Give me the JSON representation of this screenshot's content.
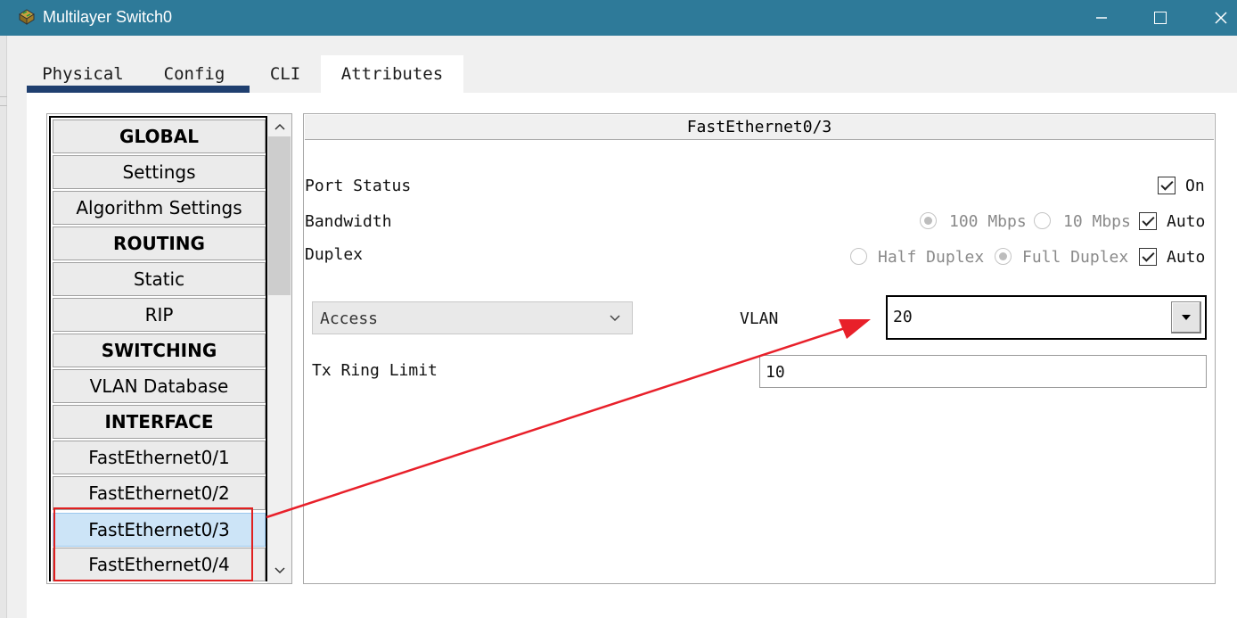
{
  "window": {
    "title": "Multilayer Switch0",
    "icon": "switch-app-icon",
    "controls": [
      "minimize-icon",
      "maximize-icon",
      "close-icon"
    ]
  },
  "tabs": [
    {
      "label": "Physical"
    },
    {
      "label": "Config"
    },
    {
      "label": "CLI"
    },
    {
      "label": "Attributes"
    }
  ],
  "active_tab": "Config",
  "sidebar": {
    "items": [
      {
        "label": "GLOBAL",
        "type": "header"
      },
      {
        "label": "Settings",
        "type": "item"
      },
      {
        "label": "Algorithm Settings",
        "type": "item"
      },
      {
        "label": "ROUTING",
        "type": "header"
      },
      {
        "label": "Static",
        "type": "item"
      },
      {
        "label": "RIP",
        "type": "item"
      },
      {
        "label": "SWITCHING",
        "type": "header"
      },
      {
        "label": "VLAN Database",
        "type": "item"
      },
      {
        "label": "INTERFACE",
        "type": "header"
      },
      {
        "label": "FastEthernet0/1",
        "type": "item"
      },
      {
        "label": "FastEthernet0/2",
        "type": "item"
      },
      {
        "label": "FastEthernet0/3",
        "type": "item",
        "selected": true
      },
      {
        "label": "FastEthernet0/4",
        "type": "item"
      }
    ]
  },
  "panel": {
    "title": "FastEthernet0/3",
    "port_status": {
      "label": "Port Status",
      "checkbox_label": "On",
      "checked": true
    },
    "bandwidth": {
      "label": "Bandwidth",
      "option_100": "100 Mbps",
      "option_10": "10 Mbps",
      "auto_label": "Auto",
      "auto_checked": true
    },
    "duplex": {
      "label": "Duplex",
      "option_half": "Half Duplex",
      "option_full": "Full Duplex",
      "auto_label": "Auto",
      "auto_checked": true
    },
    "mode": {
      "value": "Access"
    },
    "vlan": {
      "label": "VLAN",
      "value": "20"
    },
    "tx_ring": {
      "label": "Tx Ring Limit",
      "value": "10"
    }
  },
  "annotation_color": "#e02020"
}
